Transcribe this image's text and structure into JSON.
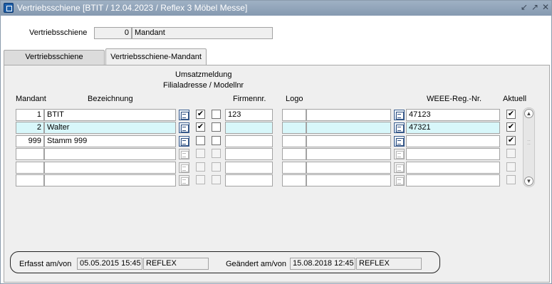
{
  "window": {
    "title": "Vertriebsschiene   [BTIT / 12.04.2023 / Reflex 3 Möbel Messe]",
    "controls": [
      "↙",
      "↗",
      "✕"
    ]
  },
  "header": {
    "label": "Vertriebsschiene",
    "number": "0",
    "name": "Mandant"
  },
  "tabs": [
    {
      "label": "Vertriebsschiene",
      "active": false
    },
    {
      "label": "Vertriebsschiene-Mandant",
      "active": true
    }
  ],
  "table": {
    "group_header_1": "Umsatzmeldung",
    "group_header_2": "Filialadresse / Modellnr",
    "columns": {
      "mandant": "Mandant",
      "bezeichnung": "Bezeichnung",
      "firmennr": "Firmennr.",
      "logo": "Logo",
      "weee": "WEEE-Reg.-Nr.",
      "aktuell": "Aktuell"
    },
    "rows": [
      {
        "mandant": "1",
        "bezeichnung": "BTIT",
        "umsatz": true,
        "filial": false,
        "firmennr": "123",
        "logo_a": "",
        "logo_b": "",
        "weee": "47123",
        "aktuell": true
      },
      {
        "mandant": "2",
        "bezeichnung": "Walter",
        "umsatz": true,
        "filial": false,
        "firmennr": "",
        "logo_a": "",
        "logo_b": "",
        "weee": "47321",
        "aktuell": true
      },
      {
        "mandant": "999",
        "bezeichnung": "Stamm 999",
        "umsatz": false,
        "filial": false,
        "firmennr": "",
        "logo_a": "",
        "logo_b": "",
        "weee": "",
        "aktuell": true
      },
      {
        "mandant": "",
        "bezeichnung": "",
        "umsatz": false,
        "filial": false,
        "firmennr": "",
        "logo_a": "",
        "logo_b": "",
        "weee": "",
        "aktuell": false
      },
      {
        "mandant": "",
        "bezeichnung": "",
        "umsatz": false,
        "filial": false,
        "firmennr": "",
        "logo_a": "",
        "logo_b": "",
        "weee": "",
        "aktuell": false
      },
      {
        "mandant": "",
        "bezeichnung": "",
        "umsatz": false,
        "filial": false,
        "firmennr": "",
        "logo_a": "",
        "logo_b": "",
        "weee": "",
        "aktuell": false
      }
    ]
  },
  "audit": {
    "created_label": "Erfasst am/von",
    "created_date": "05.05.2015 15:45",
    "created_user": "REFLEX",
    "changed_label": "Geändert am/von",
    "changed_date": "15.08.2018 12:45",
    "changed_user": "REFLEX"
  },
  "colors": {
    "titlebar": "#8fa2b8",
    "selected_row": "#d8f7fa",
    "panel": "#efefef"
  }
}
